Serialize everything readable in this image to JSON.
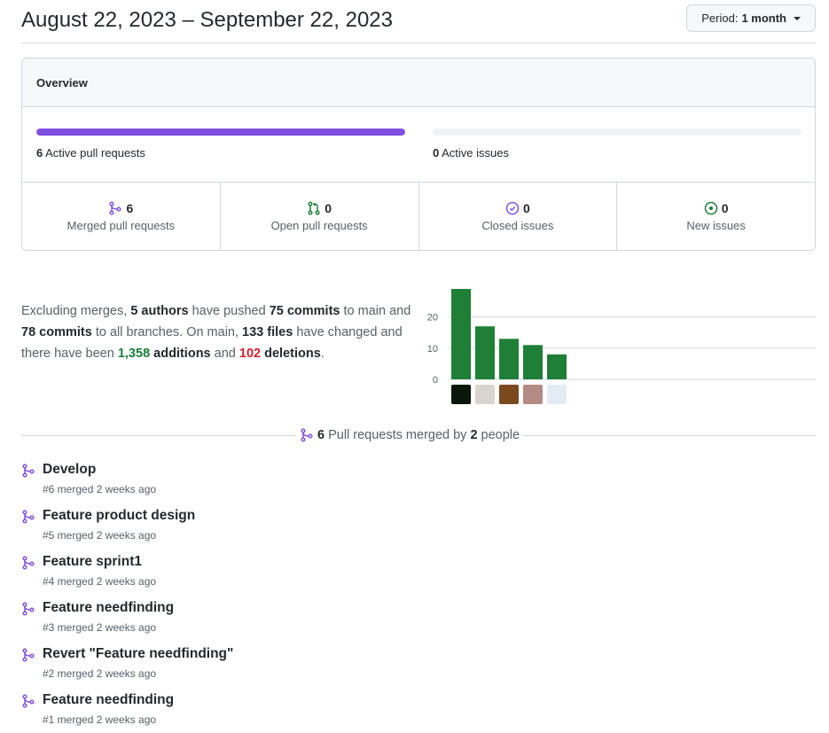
{
  "header": {
    "title": "August 22, 2023 – September 22, 2023",
    "period_label": "Period:",
    "period_value": "1 month"
  },
  "overview": {
    "heading": "Overview",
    "active_prs": {
      "count": "6",
      "label": "Active pull requests",
      "fill_fraction": 1.0,
      "color": "#8250df"
    },
    "active_issues": {
      "count": "0",
      "label": "Active issues",
      "fill_fraction": 0.0
    },
    "stats": [
      {
        "icon": "git-merge-icon",
        "value": "6",
        "label": "Merged pull requests",
        "color": "#8250df"
      },
      {
        "icon": "git-pull-request-icon",
        "value": "0",
        "label": "Open pull requests",
        "color": "#1a7f37"
      },
      {
        "icon": "issue-closed-icon",
        "value": "0",
        "label": "Closed issues",
        "color": "#8250df"
      },
      {
        "icon": "issue-opened-icon",
        "value": "0",
        "label": "New issues",
        "color": "#1a7f37"
      }
    ]
  },
  "summary": {
    "t1": "Excluding merges, ",
    "authors": "5 authors",
    "t2": " have pushed ",
    "commits_main": "75 commits",
    "t3": " to main and ",
    "commits_all": "78 commits",
    "t4": " to all branches. On main, ",
    "files": "133 files",
    "t5": " have changed and there have been ",
    "additions_num": "1,358",
    "additions_word": " additions",
    "t6": " and ",
    "deletions_num": "102",
    "deletions_word": " deletions",
    "t7": "."
  },
  "chart_data": {
    "type": "bar",
    "categories": [
      "author-1",
      "author-2",
      "author-3",
      "author-4",
      "author-5"
    ],
    "values": [
      29,
      17,
      13,
      11,
      8
    ],
    "yticks": [
      0,
      10,
      20
    ],
    "ylim": [
      0,
      29
    ],
    "bar_color": "#1f7f37",
    "xlabel": "",
    "ylabel": ""
  },
  "merged_by": {
    "count": "6",
    "text1": "Pull requests merged by",
    "people": "2",
    "text2": "people"
  },
  "pull_requests": [
    {
      "title": "Develop",
      "meta": "#6 merged 2 weeks ago"
    },
    {
      "title": "Feature product design",
      "meta": "#5 merged 2 weeks ago"
    },
    {
      "title": "Feature sprint1",
      "meta": "#4 merged 2 weeks ago"
    },
    {
      "title": "Feature needfinding",
      "meta": "#3 merged 2 weeks ago"
    },
    {
      "title": "Revert \"Feature needfinding\"",
      "meta": "#2 merged 2 weeks ago"
    },
    {
      "title": "Feature needfinding",
      "meta": "#1 merged 2 weeks ago"
    }
  ]
}
